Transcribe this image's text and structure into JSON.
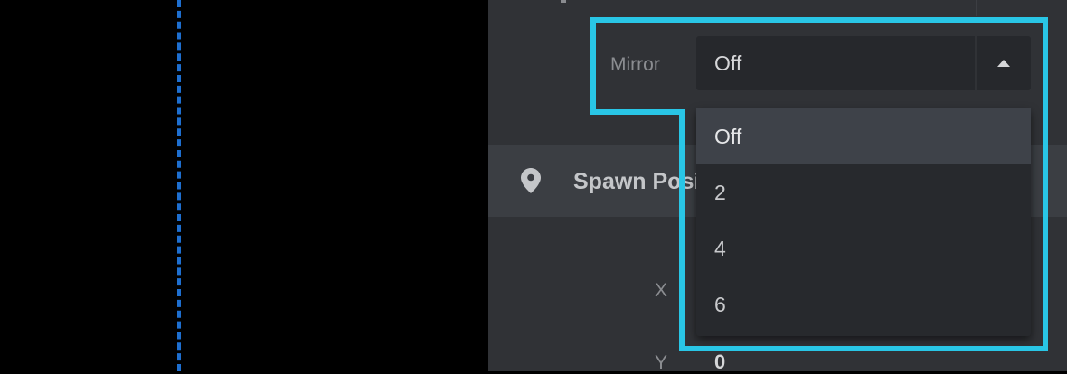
{
  "mirror": {
    "label": "Mirror",
    "selected_value": "Off",
    "options": [
      "Off",
      "2",
      "4",
      "6"
    ]
  },
  "spawn_section": {
    "title": "Spawn Position",
    "icon": "map-pin-icon"
  },
  "position": {
    "x_label": "X",
    "y_label": "Y",
    "y_value": "0"
  },
  "colors": {
    "highlight": "#29c6e6",
    "guide_line": "#1e6fd0",
    "panel_bg": "#303236"
  }
}
